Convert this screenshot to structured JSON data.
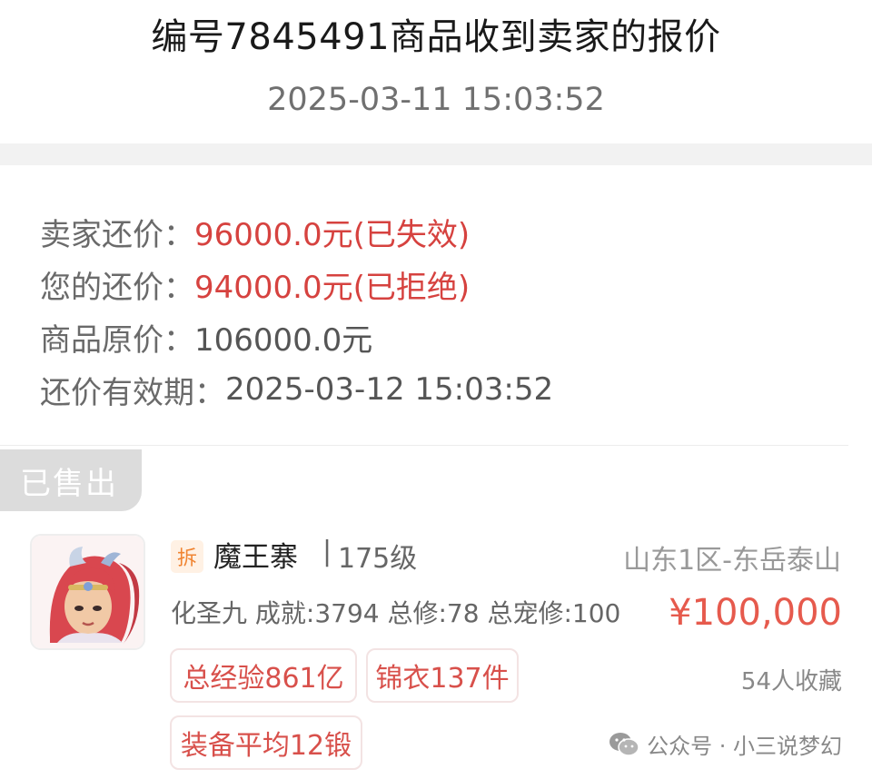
{
  "header": {
    "title": "编号7845491商品收到卖家的报价",
    "date": "2025-03-11 15:03:52"
  },
  "offer": {
    "seller_counter_label": "卖家还价：",
    "seller_counter_value": "96000.0元(已失效)",
    "your_counter_label": "您的还价：",
    "your_counter_value": "94000.0元(已拒绝)",
    "original_price_label": "商品原价：",
    "original_price_value": "106000.0元",
    "validity_label": "还价有效期：",
    "validity_value": "2025-03-12 15:03:52"
  },
  "item": {
    "status_badge": "已售出",
    "tag": "拆",
    "name": "魔王寨",
    "separator": "|",
    "level": "175级",
    "region": "山东1区-东岳泰山",
    "stats": "化圣九 成就:3794 总修:78 总宠修:100",
    "price": "¥100,000",
    "tags": [
      "总经验861亿",
      "锦衣137件",
      "装备平均12锻"
    ],
    "favorites": "54人收藏",
    "watermark": "公众号 · 小三说梦幻",
    "accent_color": "#d6423f"
  }
}
